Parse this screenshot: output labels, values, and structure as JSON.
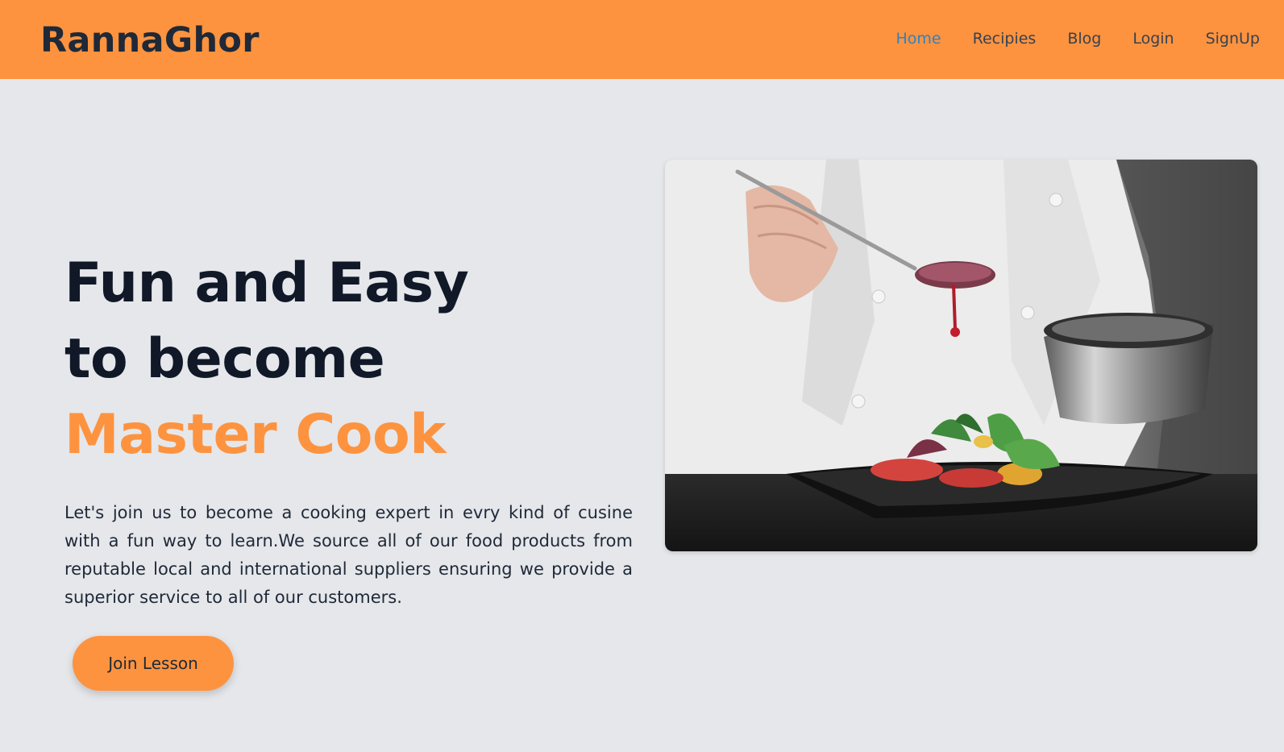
{
  "nav": {
    "brand": "RannaGhor",
    "links": [
      {
        "label": "Home",
        "active": true
      },
      {
        "label": "Recipies",
        "active": false
      },
      {
        "label": "Blog",
        "active": false
      },
      {
        "label": "Login",
        "active": false
      },
      {
        "label": "SignUp",
        "active": false
      }
    ]
  },
  "hero": {
    "headline_line1": "Fun and Easy",
    "headline_line2": "to become",
    "headline_accent": "Master Cook",
    "description": "Let's join us to become a cooking expert in evry kind of cusine with a fun way to learn.We source all of our food products from reputable local and international suppliers ensuring we provide a superior service to all of our customers.",
    "cta_label": "Join Lesson",
    "image_subject": "chef-plating-salad-image"
  },
  "colors": {
    "accent": "#fd933f",
    "background": "#e5e7eb",
    "active_link": "#2b84c4",
    "text_dark": "#111827"
  }
}
